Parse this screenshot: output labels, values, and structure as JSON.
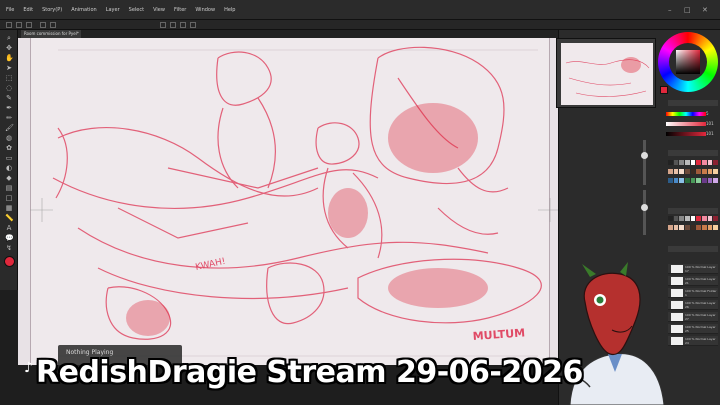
{
  "menu": {
    "items": [
      "File",
      "Edit",
      "Story(P)",
      "Animation",
      "Layer",
      "Select",
      "View",
      "Filter",
      "Window",
      "Help"
    ]
  },
  "document": {
    "tab_label": "Room commission for Pyel*"
  },
  "canvas": {
    "lettering": [
      "KWAH!",
      "MULTUM"
    ]
  },
  "color": {
    "main": "#e0283c",
    "values": [
      "5",
      "101",
      "101"
    ]
  },
  "layers": [
    {
      "label": "100 % Normal\nLayer 17"
    },
    {
      "label": "100 % Normal\nLayer 21"
    },
    {
      "label": "100 % Normal\nFolder 1"
    },
    {
      "label": "100 % Normal\nLayer 26"
    },
    {
      "label": "100 % Normal\nLayer 27"
    },
    {
      "label": "100 % Normal\nLayer 25"
    },
    {
      "label": "100 % Normal\nLayer 24"
    }
  ],
  "player": {
    "status": "Nothing Playing"
  },
  "overlay": {
    "title": "RedishDragie Stream 29-06-2026"
  }
}
